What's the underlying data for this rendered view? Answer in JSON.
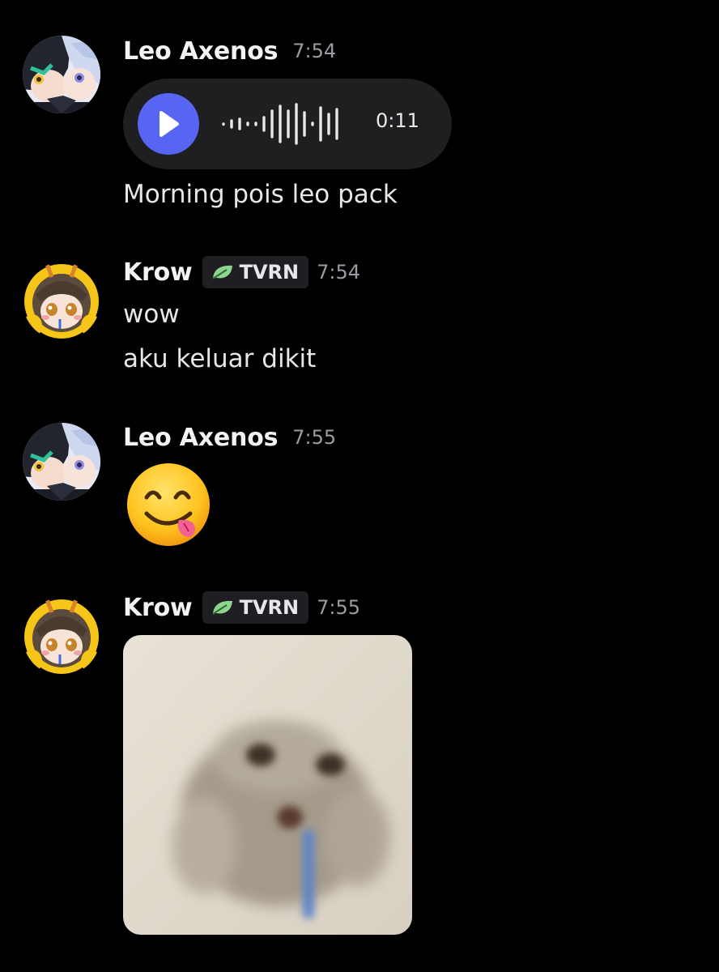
{
  "messages": [
    {
      "author": "Leo Axenos",
      "time": "7:54",
      "voice": {
        "duration": "0:11"
      },
      "lines": [
        "Morning pois leo pack"
      ]
    },
    {
      "author": "Krow",
      "tag": "TVRN",
      "time": "7:54",
      "lines": [
        "wow",
        "aku keluar dikit"
      ]
    },
    {
      "author": "Leo Axenos",
      "time": "7:55",
      "emoji": "face-savoring-food"
    },
    {
      "author": "Krow",
      "tag": "TVRN",
      "time": "7:55",
      "attachment": "image"
    }
  ],
  "colors": {
    "background": "#000000",
    "play_button": "#5865f2",
    "voice_bubble": "#1f1f22",
    "tag_background": "#1f1f23",
    "timestamp": "#9a9ca3",
    "leaf": "#8fd48e"
  },
  "icons": [
    "play-icon",
    "waveform-icon",
    "leaf-icon",
    "emoji-icon"
  ]
}
